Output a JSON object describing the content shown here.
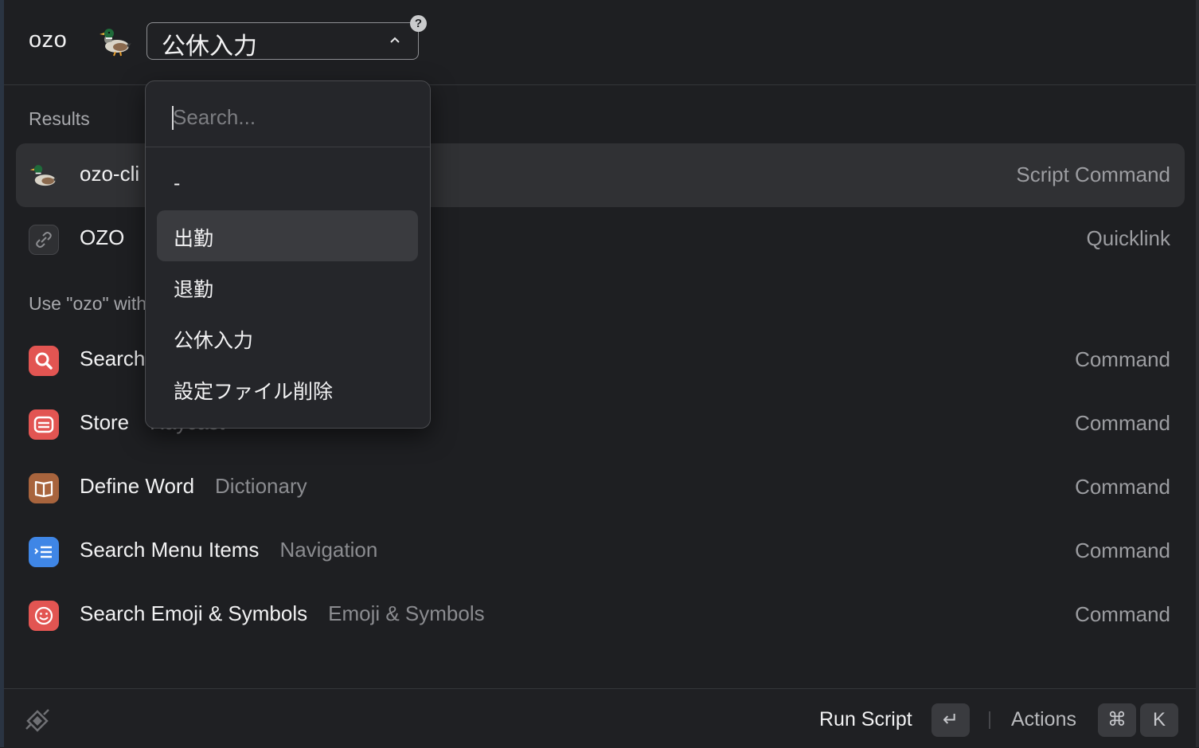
{
  "header": {
    "command_name": "ozo",
    "dropdown_value": "公休入力",
    "help_glyph": "?"
  },
  "dropdown_menu": {
    "search_placeholder": "Search...",
    "options": [
      "-",
      "出勤",
      "退勤",
      "公休入力",
      "設定ファイル削除"
    ],
    "highlighted": "出勤"
  },
  "list": {
    "section_results": "Results",
    "section_use": "Use \"ozo\" with...",
    "items": [
      {
        "title": "ozo-cli",
        "subtitle": "",
        "accessory": "Script Command",
        "icon": "duck-icon",
        "selected": true
      },
      {
        "title": "OZO",
        "subtitle": "",
        "accessory": "Quicklink",
        "icon": "link-icon"
      },
      {
        "title": "Search Files",
        "subtitle": "",
        "accessory": "Command",
        "icon": "search-icon"
      },
      {
        "title": "Store",
        "subtitle": "Raycast",
        "accessory": "Command",
        "icon": "store-icon"
      },
      {
        "title": "Define Word",
        "subtitle": "Dictionary",
        "accessory": "Command",
        "icon": "book-icon"
      },
      {
        "title": "Search Menu Items",
        "subtitle": "Navigation",
        "accessory": "Command",
        "icon": "menu-list-icon"
      },
      {
        "title": "Search Emoji & Symbols",
        "subtitle": "Emoji & Symbols",
        "accessory": "Command",
        "icon": "smiley-icon"
      }
    ]
  },
  "footer": {
    "primary_action": "Run Script",
    "enter_key": "↵",
    "actions_label": "Actions",
    "cmd_key": "⌘",
    "k_key": "K"
  },
  "colors": {
    "background": "#1e1f22",
    "selected_row": "#303134",
    "red_icon": "#e25552",
    "brown_icon": "#a8643d",
    "blue_icon": "#3f86e6"
  }
}
